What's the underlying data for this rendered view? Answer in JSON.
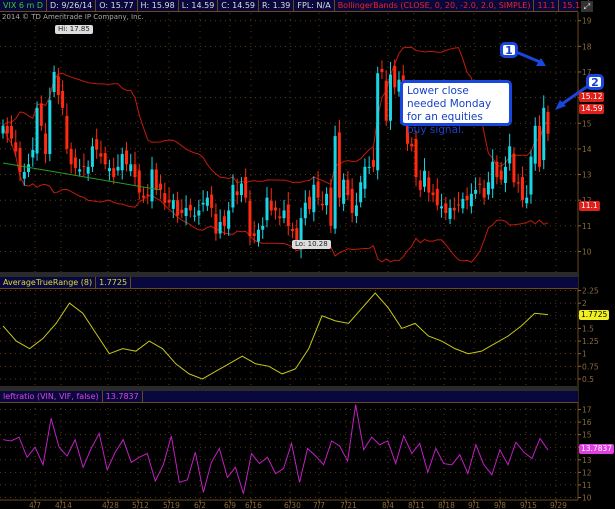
{
  "header": {
    "symbol": "VIX 6 m D",
    "date": "D: 9/26/14",
    "open": "O: 15.77",
    "high": "H: 15.98",
    "low": "L: 14.59",
    "close": "C: 14.59",
    "range": "R: 1.39",
    "fpl": "FPL: N/A",
    "study": "BollingerBands (CLOSE, 0, 20, -2.0, 2.0, SIMPLE)",
    "bb_lower": "11.1",
    "bb_upper": "15.12"
  },
  "copyright": "2014 © TD Ameritrade IP Company, Inc.",
  "labels": {
    "hi": "Hi: 17.85",
    "lo": "Lo: 10.28"
  },
  "price_tags": {
    "upper": "15.12",
    "close": "14.59",
    "lower": "11.1"
  },
  "annotations": {
    "callout": "Lower close needed Monday for an equities buy signal.",
    "marker1": "1",
    "marker2": "2"
  },
  "atr": {
    "title": "AverageTrueRange (8)",
    "value": "1.7725"
  },
  "leftratio": {
    "title": "leftratio (VIN, VIF, false)",
    "value": "13.7837"
  },
  "colors": {
    "up": "#19d6e6",
    "down": "#ff2a10",
    "band": "#c41a0a",
    "trend": "#22a022",
    "atr": "#c8c81a",
    "ratio": "#c020c0",
    "grid": "#5a3c14"
  },
  "chart_data": [
    {
      "type": "candlestick",
      "title": "VIX 6 m D",
      "ylim": [
        9.2,
        19.3
      ],
      "yticks": [
        "19",
        "18",
        "17",
        "16",
        "15",
        "14",
        "13",
        "12",
        "11",
        "10"
      ],
      "close": [
        14.9,
        14.6,
        14.4,
        13.9,
        13.1,
        13.1,
        13.4,
        13.96,
        15.6,
        14.9,
        13.8,
        15.9,
        17.0,
        16.1,
        15.6,
        14.0,
        13.4,
        13.25,
        13.2,
        13.3,
        13.3,
        14.1,
        13.97,
        13.7,
        13.4,
        13.25,
        12.9,
        13.3,
        13.8,
        13.4,
        13.4,
        12.9,
        12.3,
        12.1,
        12.2,
        13.2,
        12.4,
        12.4,
        11.9,
        11.9,
        12.0,
        11.4,
        11.5,
        11.7,
        11.6,
        11.4,
        11.6,
        11.9,
        12.1,
        11.7,
        10.7,
        11.15,
        11.0,
        11.6,
        12.6,
        12.2,
        12.65,
        12.1,
        10.6,
        10.6,
        10.85,
        11.0,
        12.1,
        11.6,
        11.6,
        11.3,
        11.6,
        10.99,
        10.8,
        10.3,
        11.3,
        11.9,
        11.65,
        12.6,
        12.1,
        11.8,
        12.25,
        11.0,
        14.5,
        12.1,
        12.8,
        12.2,
        11.5,
        11.8,
        12.7,
        13.3,
        13.3,
        13.3,
        16.95,
        17.0,
        15.1,
        16.9,
        16.4,
        16.7,
        15.8,
        14.2,
        14.1,
        12.9,
        12.4,
        13.15,
        12.3,
        12.2,
        11.8,
        11.76,
        11.5,
        11.7,
        11.6,
        11.8,
        12.05,
        12.0,
        12.25,
        12.4,
        12.6,
        12.1,
        12.7,
        13.5,
        12.9,
        12.8,
        13.3,
        14.1,
        12.7,
        12.65,
        12.0,
        12.1,
        13.7,
        14.9,
        13.3,
        15.6,
        14.59
      ],
      "first_open": 14.6,
      "bollinger": {
        "length": 20,
        "num_dev": 2.0
      },
      "trendline": {
        "from": [
          0,
          13.45
        ],
        "to": [
          37,
          12.4
        ]
      },
      "xticks": [
        "4/7",
        "4/14",
        "4/28",
        "5/12",
        "5/19",
        "6/2",
        "6/9",
        "6/16",
        "6/30",
        "7/7",
        "7/21",
        "8/4",
        "8/11",
        "8/18",
        "9/1",
        "9/8",
        "9/15",
        "9/29"
      ]
    },
    {
      "type": "line",
      "title": "AverageTrueRange (8)",
      "ylim": [
        0.4,
        2.3
      ],
      "yticks": [
        "2.25",
        "2",
        "1.75",
        "1.5",
        "1.25",
        "1",
        "0.75",
        "0.5"
      ],
      "values": [
        1.55,
        1.25,
        1.1,
        1.3,
        1.6,
        2.0,
        1.8,
        1.4,
        1.0,
        1.1,
        1.05,
        1.25,
        1.1,
        0.8,
        0.6,
        0.5,
        0.65,
        0.8,
        0.95,
        0.8,
        0.75,
        0.6,
        0.7,
        1.1,
        1.75,
        1.65,
        1.6,
        1.9,
        2.2,
        1.9,
        1.5,
        1.6,
        1.35,
        1.25,
        1.1,
        1.0,
        1.05,
        1.2,
        1.35,
        1.55,
        1.8,
        1.7725
      ]
    },
    {
      "type": "line",
      "title": "leftratio (VIN, VIF, false)",
      "ylim": [
        9.8,
        17.6
      ],
      "yticks": [
        "17",
        "16",
        "15",
        "14",
        "13",
        "12",
        "11",
        "10"
      ],
      "values": [
        14.6,
        14.5,
        14.8,
        13.2,
        14.0,
        12.6,
        16.3,
        14.0,
        13.3,
        14.6,
        12.4,
        13.9,
        15.1,
        12.2,
        13.6,
        14.6,
        12.8,
        13.2,
        13.5,
        11.3,
        12.6,
        14.9,
        11.2,
        11.4,
        13.6,
        10.4,
        12.8,
        13.9,
        11.6,
        12.4,
        10.3,
        13.5,
        12.7,
        13.2,
        11.9,
        12.3,
        14.3,
        11.2,
        13.9,
        13.3,
        12.6,
        14.5,
        14.1,
        12.9,
        17.4,
        13.8,
        14.8,
        14.2,
        14.5,
        12.7,
        14.9,
        13.5,
        14.3,
        12.0,
        13.9,
        12.7,
        12.6,
        13.4,
        11.9,
        14.2,
        12.6,
        11.8,
        13.8,
        12.6,
        14.4,
        13.6,
        13.1,
        14.7,
        13.7837
      ]
    }
  ]
}
